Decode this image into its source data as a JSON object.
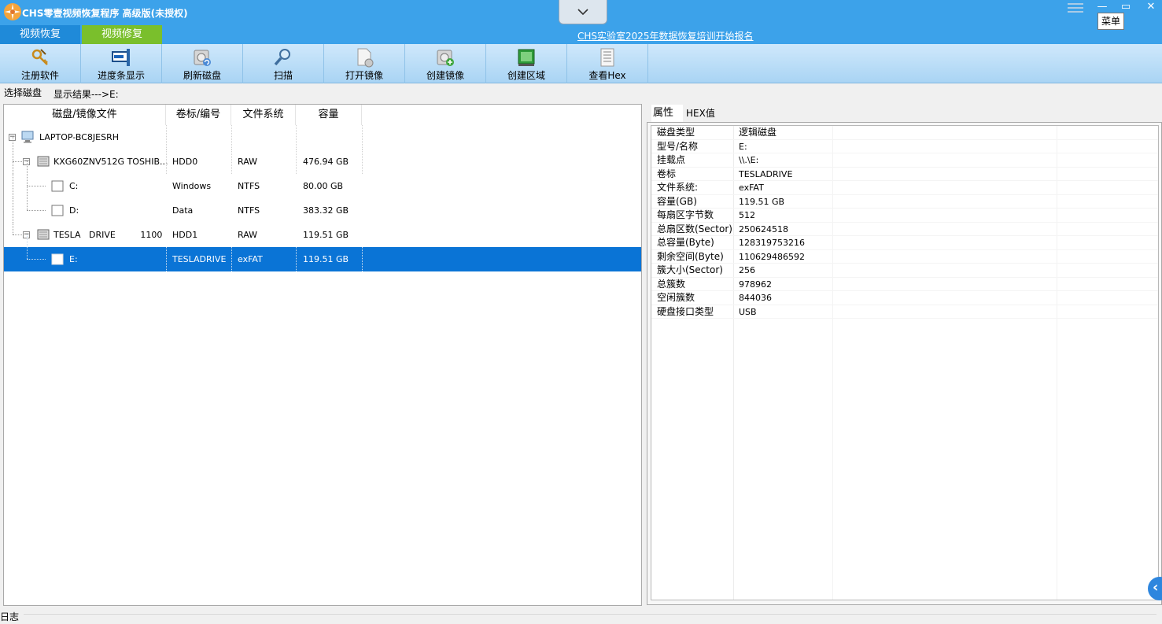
{
  "window": {
    "title": "CHS零壹视频恢复程序 高级版(未授权)",
    "menu_label": "菜单",
    "minimize": "—",
    "restore": "▭",
    "close": "✕"
  },
  "tabs": [
    {
      "label": "视频恢复"
    },
    {
      "label": "视频修复"
    }
  ],
  "promo": "CHS实验室2025年数据恢复培训开始报名",
  "toolbar": [
    {
      "label": "注册软件",
      "icon": "key-icon"
    },
    {
      "label": "进度条显示",
      "icon": "progress-display-icon"
    },
    {
      "label": "刷新磁盘",
      "icon": "refresh-disk-icon"
    },
    {
      "label": "扫描",
      "icon": "magnifier-icon"
    },
    {
      "label": "打开镜像",
      "icon": "open-image-icon"
    },
    {
      "label": "创建镜像",
      "icon": "create-image-icon"
    },
    {
      "label": "创建区域",
      "icon": "create-region-icon"
    },
    {
      "label": "查看Hex",
      "icon": "hex-view-icon"
    }
  ],
  "breadcrumb": {
    "tab": "选择磁盘",
    "path": "显示结果--->E:"
  },
  "disk_table": {
    "columns": [
      "磁盘/镜像文件",
      "卷标/编号",
      "文件系统",
      "容量"
    ],
    "rows": [
      {
        "name": "LAPTOP-BC8JESRH",
        "label": "",
        "fs": "",
        "size": "",
        "level": 0,
        "type": "computer",
        "expanded": true
      },
      {
        "name": "KXG60ZNV512G TOSHIB...",
        "label": "HDD0",
        "fs": "RAW",
        "size": "476.94 GB",
        "level": 1,
        "type": "disk",
        "expanded": true
      },
      {
        "name": "C:",
        "label": "Windows",
        "fs": "NTFS",
        "size": "80.00 GB",
        "level": 2,
        "type": "volume"
      },
      {
        "name": "D:",
        "label": "Data",
        "fs": "NTFS",
        "size": "383.32 GB",
        "level": 2,
        "type": "volume"
      },
      {
        "name": "TESLA   DRIVE         1100",
        "label": "HDD1",
        "fs": "RAW",
        "size": "119.51 GB",
        "level": 1,
        "type": "disk",
        "expanded": true
      },
      {
        "name": "E:",
        "label": "TESLADRIVE",
        "fs": "exFAT",
        "size": "119.51 GB",
        "level": 2,
        "type": "volume",
        "selected": true
      }
    ]
  },
  "properties": {
    "tabs": [
      "属性",
      "HEX值"
    ],
    "rows": [
      {
        "key": "磁盘类型",
        "value": "逻辑磁盘"
      },
      {
        "key": "型号/名称",
        "value": "E:"
      },
      {
        "key": "挂载点",
        "value": "\\\\.\\E:"
      },
      {
        "key": "卷标",
        "value": "TESLADRIVE"
      },
      {
        "key": "文件系统:",
        "value": "exFAT"
      },
      {
        "key": "容量(GB)",
        "value": "119.51 GB"
      },
      {
        "key": "每扇区字节数",
        "value": "512"
      },
      {
        "key": "总扇区数(Sector)",
        "value": "250624518"
      },
      {
        "key": "总容量(Byte)",
        "value": "128319753216"
      },
      {
        "key": "剩余空间(Byte)",
        "value": "110629486592"
      },
      {
        "key": "簇大小(Sector)",
        "value": "256"
      },
      {
        "key": "总簇数",
        "value": "978962"
      },
      {
        "key": "空闲簇数",
        "value": "844036"
      },
      {
        "key": "硬盘接口类型",
        "value": "USB"
      }
    ]
  },
  "log": {
    "label": "日志"
  },
  "colors": {
    "titlebar": "#3ca2ea",
    "tab_active": "#1f8ad9",
    "tab_repair": "#7abf2c",
    "selection": "#0a74d6"
  }
}
